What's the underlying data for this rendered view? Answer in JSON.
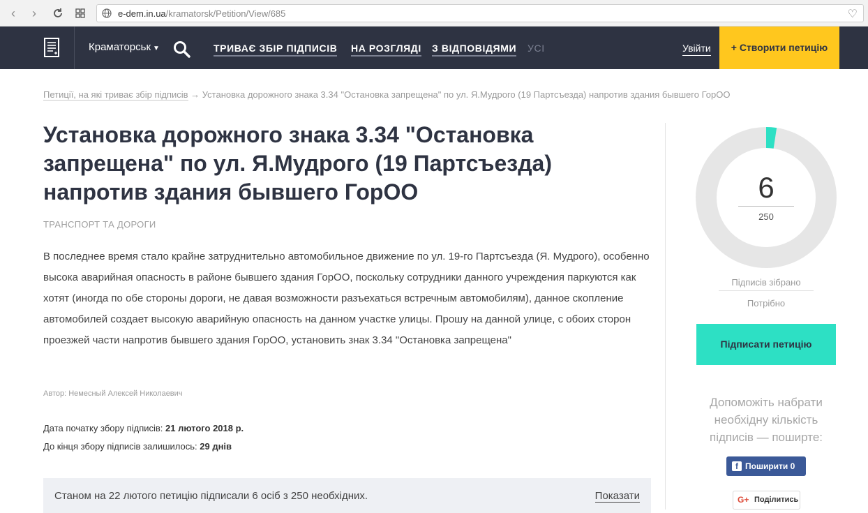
{
  "browser": {
    "url_host": "e-dem.in.ua",
    "url_path": "/kramatorsk/Petition/View/685"
  },
  "header": {
    "city": "Краматорськ",
    "nav": [
      {
        "label": "ТРИВАЄ ЗБІР ПІДПИСІВ"
      },
      {
        "label": "НА РОЗГЛЯДІ"
      },
      {
        "label": "З ВІДПОВІДЯМИ"
      },
      {
        "label": "УСІ"
      }
    ],
    "login": "Увійти",
    "create": "+ Створити петицію"
  },
  "breadcrumb": {
    "link": "Петиції, на які триває збір підписів",
    "current": " → Установка дорожного знака 3.34 \"Остановка запрещена\" по ул. Я.Мудрого (19 Партсъезда) напротив здания бывшего ГорОО"
  },
  "petition": {
    "title": "Установка дорожного знака 3.34 \"Остановка запрещена\" по ул. Я.Мудрого (19 Партсъезда) напротив здания бывшего ГорОО",
    "category": "ТРАНСПОРТ ТА ДОРОГИ",
    "body": "В последнее время стало крайне затруднительно автомобильное движение по ул. 19-го Партсъезда (Я. Мудрого), особенно высока аварийная опасность в районе бывшего здания ГорОО, поскольку сотрудники данного учреждения паркуются как хотят (иногда по обе стороны дороги, не давая возможности разъехаться встречным автомобилям), данное скопление автомобилей создает высокую аварийную опасность на данном участке улицы. Прошу на данной улице, с обоих сторон проезжей части напротив бывшего здания ГорОО, установить знак 3.34 \"Остановка запрещена\"",
    "author": "Автор: Немесный Алексей Николаевич",
    "start_label": "Дата початку збору підписів: ",
    "start_value": "21 лютого 2018 р.",
    "remaining_label": "До кінця збору підписів залишилось: ",
    "remaining_value": "29 днів",
    "status_text": "Станом на 22 лютого петицію підписали 6 осіб з 250 необхідних.",
    "show_label": "Показати"
  },
  "sidebar": {
    "signed": 6,
    "goal": 250,
    "signed_text": "6",
    "goal_text": "250",
    "collected_label": "Підписів зібрано",
    "needed_label": "Потрібно",
    "sign_button": "Підписати петицію",
    "help_text": "Допоможіть набрати необхідну кількість підписів — поширте:",
    "fb_icon": "f",
    "fb_share": "Поширити 0",
    "gp_icon": "G+",
    "gp_share": "Поділитись"
  },
  "colors": {
    "header_bg": "#2e3342",
    "accent_yellow": "#ffc71e",
    "accent_teal": "#2de0c4",
    "facebook": "#3b5998"
  },
  "icons": [
    "back-icon",
    "forward-icon",
    "reload-icon",
    "apps-grid-icon",
    "globe-icon",
    "heart-icon",
    "document-logo-icon",
    "search-icon",
    "chevron-down-icon",
    "facebook-icon",
    "google-plus-icon"
  ]
}
